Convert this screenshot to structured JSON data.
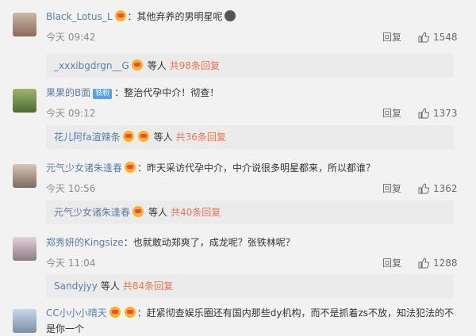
{
  "comments": [
    {
      "username": "Black_Lotus_L",
      "badge": "",
      "text": "：其他弃养的男明星呢",
      "time": "今天 09:42",
      "reply_label": "回复",
      "likes": "1548",
      "sub": {
        "name": "_xxxibgdrgn__G",
        "others": "等人",
        "count": "共98条回复"
      }
    },
    {
      "username": "果果的B面",
      "badge": "铁粉",
      "text": "：整治代孕中介！彻查！",
      "time": "今天 09:12",
      "reply_label": "回复",
      "likes": "1373",
      "sub": {
        "name": "花儿阿fa渲辣条",
        "others": "等人",
        "count": "共36条回复"
      }
    },
    {
      "username": "元气少女诸朱逢春",
      "badge": "",
      "text": "：昨天采访代孕中介，中介说很多明星都来，所以都谁？",
      "time": "今天 10:56",
      "reply_label": "回复",
      "likes": "1362",
      "sub": {
        "name": "元气少女诸朱逢春",
        "others": "等人",
        "count": "共40条回复"
      }
    },
    {
      "username": "郑秀妍的Kingsize",
      "badge": "",
      "text": "：也就敢动郑爽了，成龙呢？张铁林呢？",
      "time": "今天 11:04",
      "reply_label": "回复",
      "likes": "1288",
      "sub": {
        "name": "Sandyjyy",
        "others": "等人",
        "count": "共84条回复"
      }
    },
    {
      "username": "CC小小小晴天",
      "badge": "",
      "text": "：赶紧彻查娱乐圈还有国内那些dy机构，而不是抓着zs不放，知法犯法的不",
      "text2": "是你一个"
    }
  ],
  "colors": {
    "name_orange": "#eb7350",
    "name_blue": "#5a7ea8",
    "count_orange": "#eb7350"
  }
}
